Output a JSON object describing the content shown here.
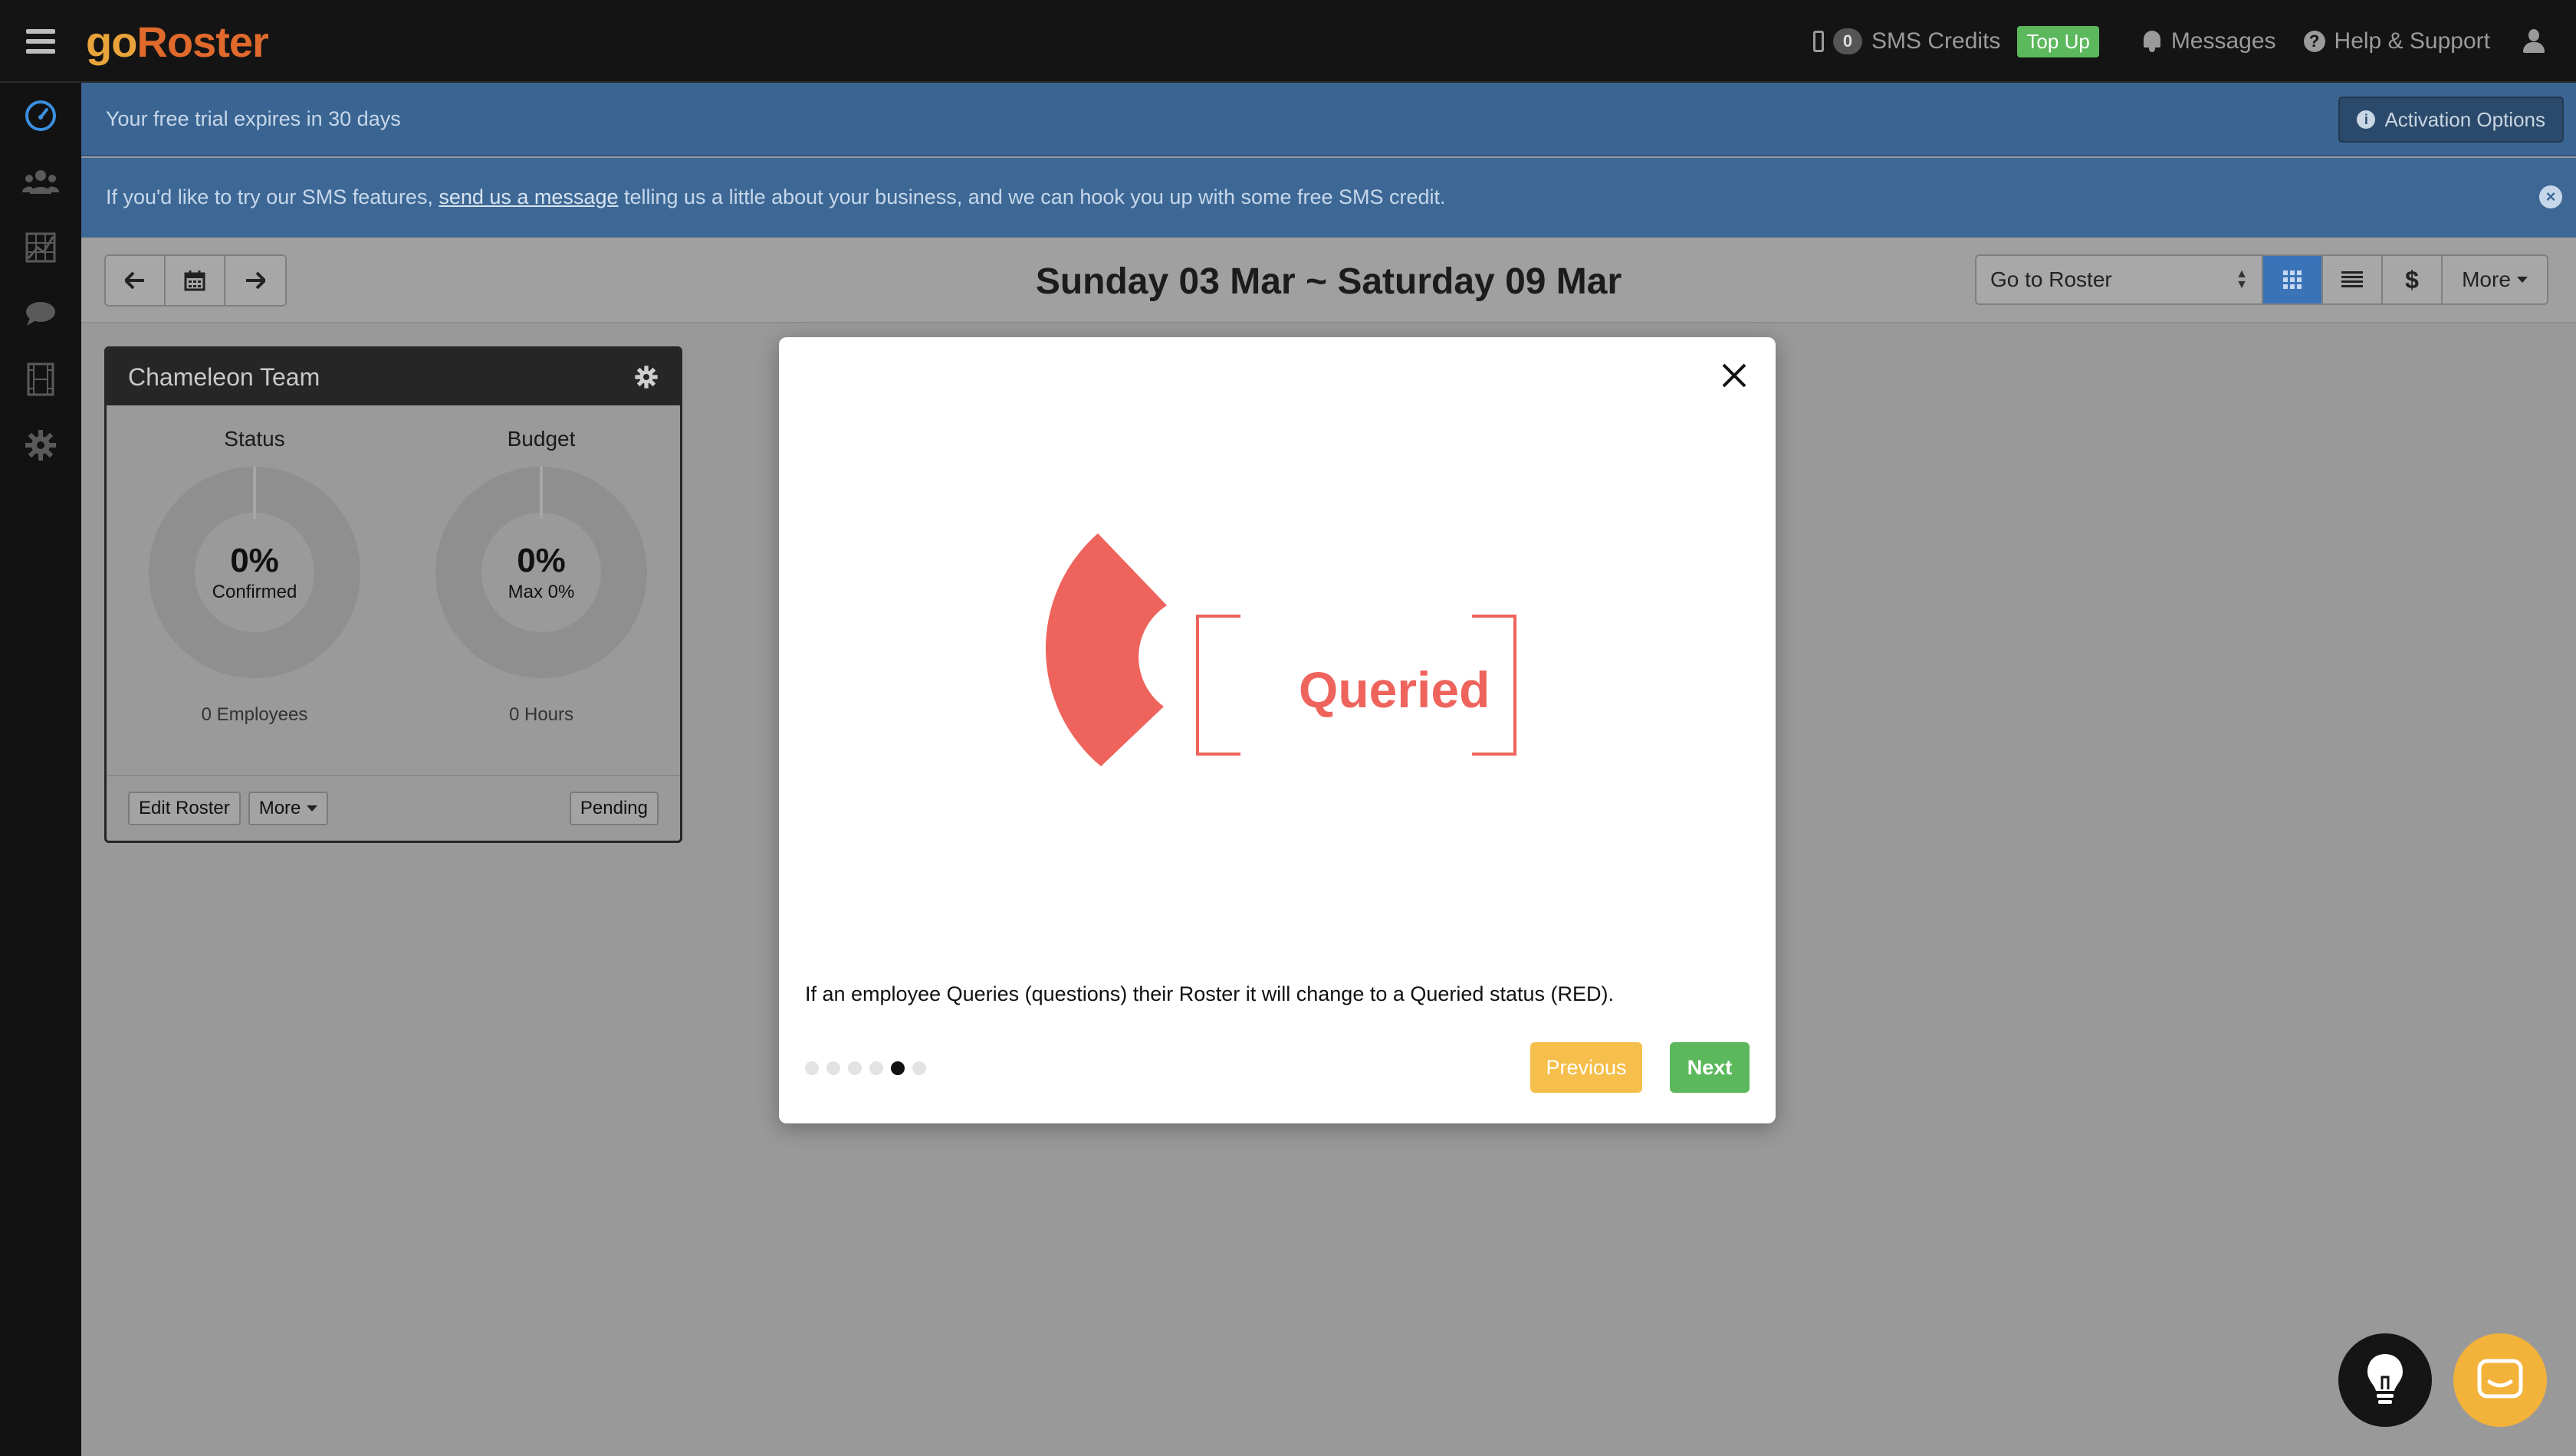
{
  "app": {
    "logo_go": "go",
    "logo_roster": "Roster",
    "sms_credit_count": "0",
    "sms_credits_label": "SMS Credits",
    "top_up_label": "Top Up",
    "messages_label": "Messages",
    "help_label": "Help & Support"
  },
  "banners": {
    "trial_text": "Your free trial expires in 30 days",
    "activation_label": "Activation Options",
    "sms_prefix": "If you'd like to try our SMS features, ",
    "sms_link": "send us a message",
    "sms_suffix": " telling us a little about your business, and we can hook you up with some free SMS credit."
  },
  "toolbar": {
    "week_title": "Sunday 03 Mar ~ Saturday 09 Mar",
    "goto_value": "Go to Roster",
    "dollar_label": "$",
    "more_label": "More"
  },
  "team": {
    "title": "Chameleon Team",
    "status_label": "Status",
    "status_value": "0%",
    "status_sub": "Confirmed",
    "status_foot": "0 Employees",
    "budget_label": "Budget",
    "budget_value": "0%",
    "budget_sub": "Max 0%",
    "budget_foot": "0 Hours",
    "edit_label": "Edit Roster",
    "more_label": "More",
    "pending_label": "Pending"
  },
  "modal": {
    "badge_text": "Queried",
    "description": "If an employee Queries (questions) their Roster it will change to a Queried status (RED).",
    "previous_label": "Previous",
    "next_label": "Next",
    "current_step": 5,
    "total_steps": 6
  },
  "colors": {
    "queried_red": "#ee645d",
    "banner_blue": "#3a6592",
    "next_green": "#5cb85c",
    "prev_yellow": "#f6be4a",
    "logo_orange": "#e06a2c"
  }
}
